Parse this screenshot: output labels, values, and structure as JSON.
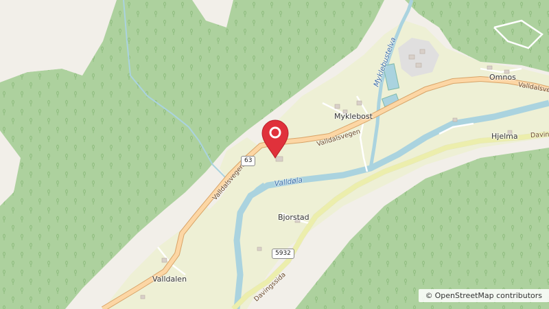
{
  "map": {
    "places": {
      "myklebost": "Myklebost",
      "omnos": "Omnos",
      "hjelma": "Hjelma",
      "bjorstad": "Bjorstad",
      "valldalen": "Valldalen"
    },
    "roads": {
      "valldalsvegen_west": "Valldalsvegen",
      "valldalsvegen_mid": "Valldalsvegen",
      "valldalsvegen_east": "Valldalsveg",
      "davingssida_south": "Davingssida",
      "davingssida_east": "Davin"
    },
    "road_refs": {
      "r63": "63",
      "r5932": "5932"
    },
    "water": {
      "valldola": "Valldøla",
      "myklebustelva": "Myklebustelva"
    },
    "marker": {
      "icon": "map-pin-icon",
      "color": "#e0313b"
    },
    "colors": {
      "forest": "#add19e",
      "farmland": "#eef0d5",
      "water": "#aad3df",
      "primary_road": "#fcd6a4",
      "bare_rock": "#f2efe9"
    }
  },
  "attribution": {
    "symbol": "©",
    "text": "OpenStreetMap contributors"
  }
}
